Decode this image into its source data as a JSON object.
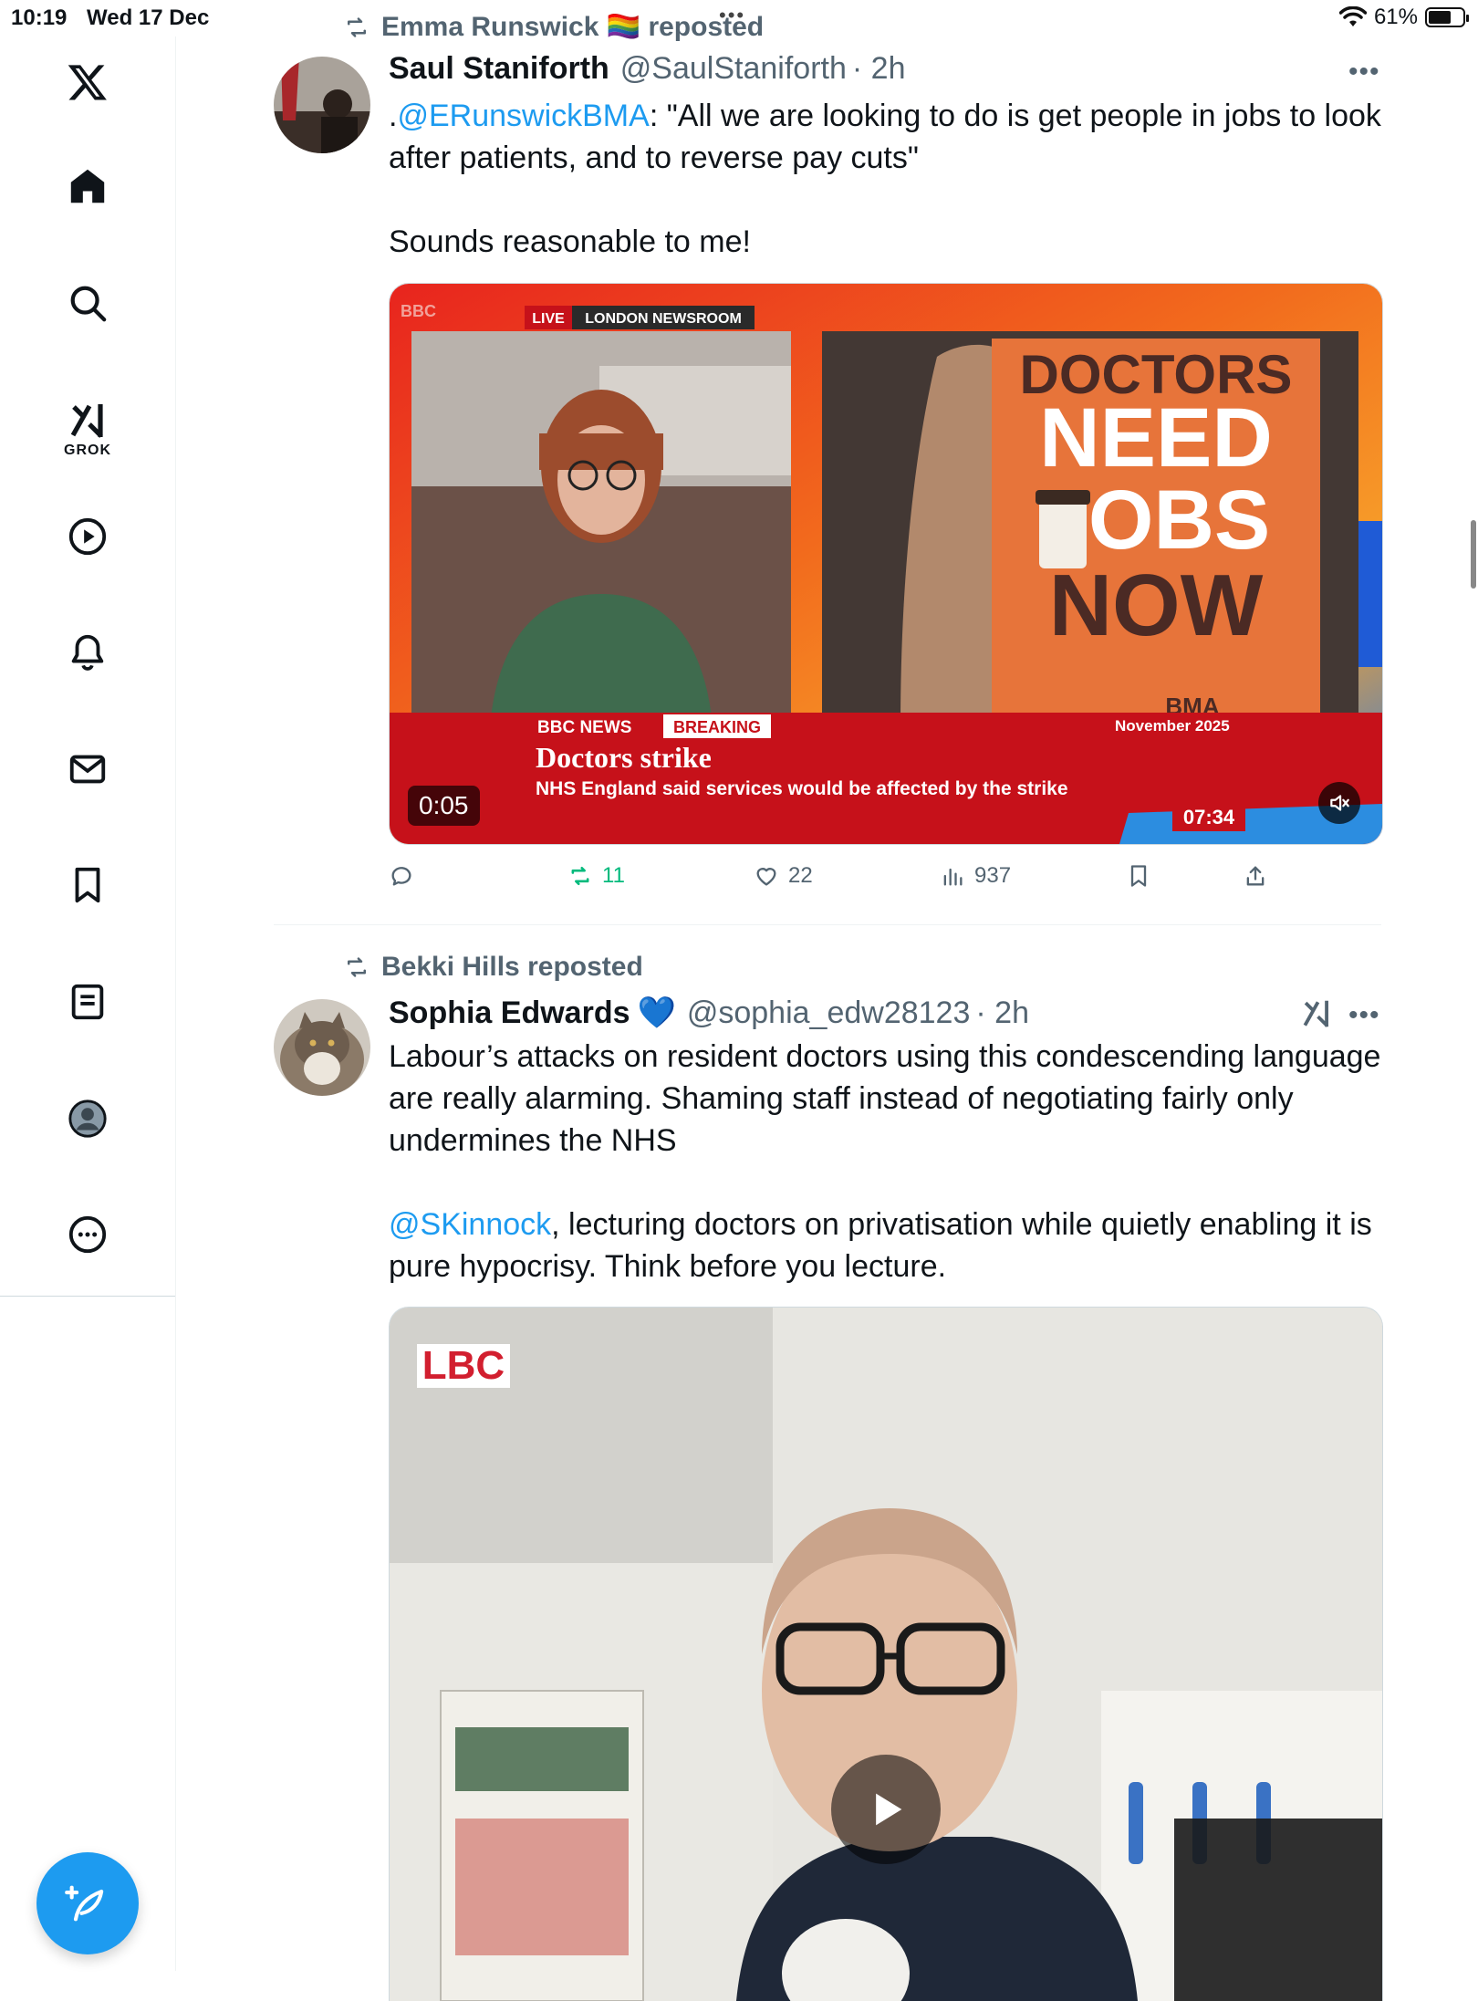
{
  "status_bar": {
    "time": "10:19",
    "date": "Wed 17 Dec",
    "battery": "61%"
  },
  "sidebar": {
    "items": [
      {
        "name": "home"
      },
      {
        "name": "explore"
      },
      {
        "name": "grok",
        "label": "GROK"
      },
      {
        "name": "video"
      },
      {
        "name": "notifications"
      },
      {
        "name": "messages"
      },
      {
        "name": "bookmarks"
      },
      {
        "name": "lists"
      },
      {
        "name": "profile"
      },
      {
        "name": "more"
      }
    ]
  },
  "posts": [
    {
      "reposted_by": "Emma Runswick 🏳️‍🌈 reposted",
      "author_name": "Saul Staniforth",
      "author_handle": "@SaulStaniforth",
      "time": "· 2h",
      "text_prefix": ".",
      "mention": "@ERunswickBMA",
      "text_line1_rest": ": \"All we are looking to do is get people in jobs to look after patients, and to reverse pay cuts\"",
      "text_line2": "Sounds reasonable to me!",
      "media": {
        "channel_logo": "BBC",
        "live_label": "LIVE",
        "live_location": "LONDON NEWSROOM",
        "sign_line1": "DOCTORS",
        "sign_line2": "NEED",
        "sign_line3": "JOBS",
        "sign_line4": "NOW",
        "sign_footer": "BMA",
        "ticker_brand": "BBC NEWS",
        "ticker_tag": "BREAKING",
        "ticker_date": "November 2025",
        "ticker_headline": "Doctors strike",
        "ticker_sub": "NHS England said services would be affected by the strike",
        "ticker_clock": "07:34",
        "elapsed": "0:05"
      },
      "stats": {
        "reposts": "11",
        "likes": "22",
        "views": "937"
      }
    },
    {
      "reposted_by": "Bekki Hills reposted",
      "author_name": "Sophia Edwards",
      "author_badge": "💙",
      "author_handle": "@sophia_edw28123",
      "time": "· 2h",
      "text_para1": "Labour’s attacks on resident doctors using this condescending language are really alarming. Shaming staff instead of negotiating fairly only undermines the NHS",
      "mention": "@SKinnock",
      "text_para2_rest": ", lecturing doctors on privatisation while quietly enabling it is pure hypocrisy. Think before you lecture.",
      "media": {
        "channel_logo": "LBC"
      }
    }
  ],
  "colors": {
    "accent": "#1d9bf0",
    "repost_green": "#00ba7c",
    "bbc_red": "#d6121a"
  }
}
